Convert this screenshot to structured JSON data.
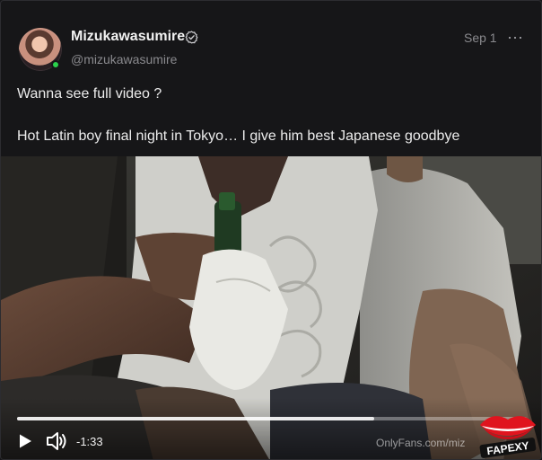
{
  "post": {
    "author_name": "Mizukawasumire",
    "author_handle": "@mizukawasumire",
    "date": "Sep 1",
    "more_icon": "⋯",
    "text_line1": "Wanna see full video ?",
    "text_line2": "Hot Latin boy final night in Tokyo… I give him best Japanese goodbye"
  },
  "video": {
    "time_remaining": "-1:33",
    "progress_fraction": 0.7,
    "watermark": "OnlyFans.com/miz",
    "overlay_logo_text": "FAPEXY"
  },
  "colors": {
    "background": "#161618",
    "online": "#2bd04b",
    "logo_red": "#e0141e"
  },
  "icons": {
    "verified": "verified-check-icon",
    "play": "play-icon",
    "volume": "volume-icon",
    "more": "more-horizontal-icon"
  }
}
